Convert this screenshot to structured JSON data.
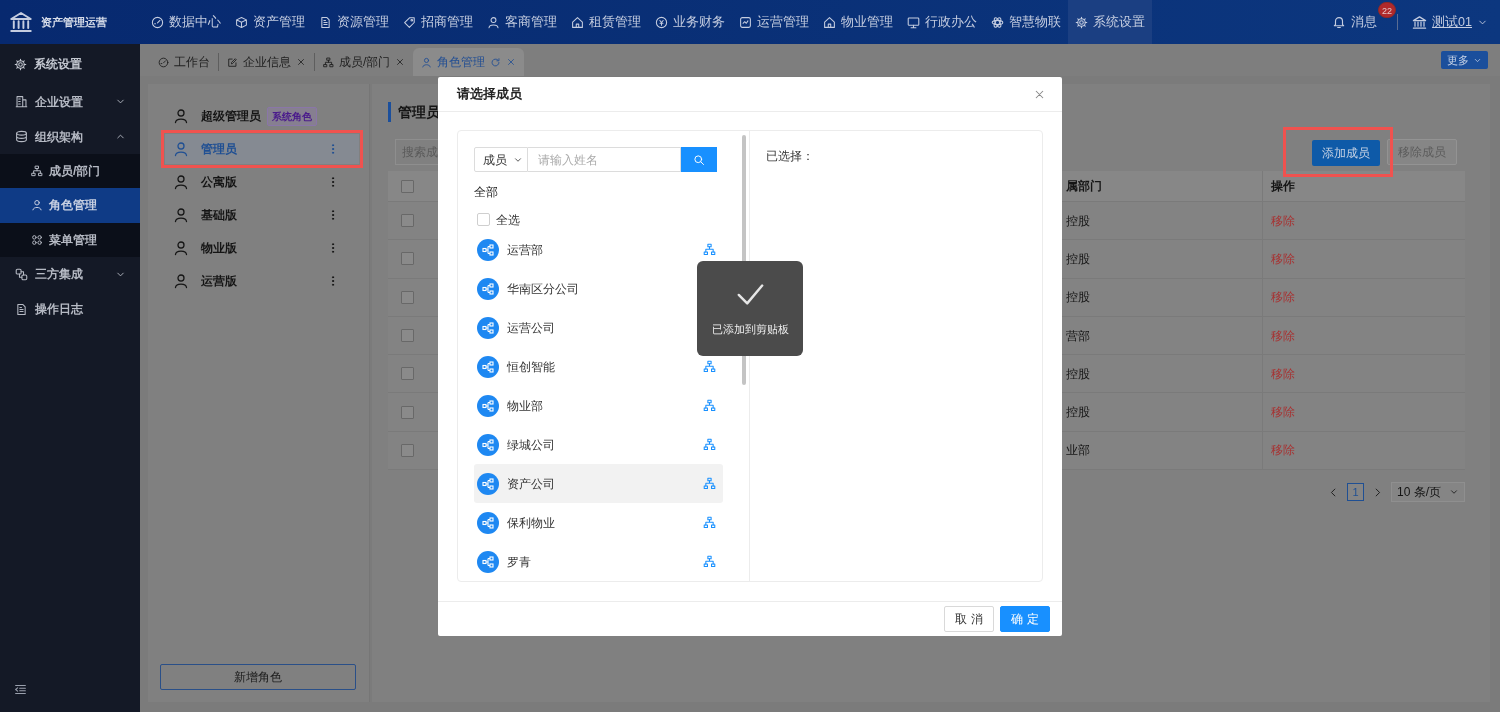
{
  "topbar": {
    "app_name": "资产管理运营",
    "nav": [
      {
        "label": "数据中心",
        "selected": false
      },
      {
        "label": "资产管理",
        "selected": false
      },
      {
        "label": "资源管理",
        "selected": false
      },
      {
        "label": "招商管理",
        "selected": false
      },
      {
        "label": "客商管理",
        "selected": false
      },
      {
        "label": "租赁管理",
        "selected": false
      },
      {
        "label": "业务财务",
        "selected": false
      },
      {
        "label": "运营管理",
        "selected": false
      },
      {
        "label": "物业管理",
        "selected": false
      },
      {
        "label": "行政办公",
        "selected": false
      },
      {
        "label": "智慧物联",
        "selected": false
      },
      {
        "label": "系统设置",
        "selected": true
      }
    ],
    "messages": {
      "label": "消息",
      "count": "22"
    },
    "user": {
      "name": "测试01"
    }
  },
  "sidebar": {
    "title": "系统设置",
    "items": [
      {
        "kind": "group",
        "label": "企业设置",
        "expanded": false
      },
      {
        "kind": "group",
        "label": "组织架构",
        "expanded": true,
        "children": [
          {
            "label": "成员/部门",
            "selected": false
          },
          {
            "label": "角色管理",
            "selected": true
          },
          {
            "label": "菜单管理",
            "selected": false
          }
        ]
      },
      {
        "kind": "group",
        "label": "三方集成",
        "expanded": false
      },
      {
        "kind": "link",
        "label": "操作日志"
      }
    ]
  },
  "tabs": [
    {
      "label": "工作台",
      "selected": false,
      "closable": false
    },
    {
      "label": "企业信息",
      "selected": false,
      "closable": true
    },
    {
      "label": "成员/部门",
      "selected": false,
      "closable": true
    },
    {
      "label": "角色管理",
      "selected": true,
      "closable": true
    }
  ],
  "more_button": "更多",
  "roles": {
    "items": [
      {
        "name": "超级管理员",
        "badge": "系统角色",
        "selected": false,
        "highlighted": false
      },
      {
        "name": "管理员",
        "selected": true,
        "highlighted": true
      },
      {
        "name": "公寓版",
        "selected": false,
        "highlighted": false
      },
      {
        "name": "基础版",
        "selected": false,
        "highlighted": false
      },
      {
        "name": "物业版",
        "selected": false,
        "highlighted": false
      },
      {
        "name": "运营版",
        "selected": false,
        "highlighted": false
      }
    ],
    "add_button": "新增角色"
  },
  "members_panel": {
    "title": "管理员",
    "search_placeholder": "搜索成",
    "add_button": {
      "label": "添加成员",
      "highlighted": true
    },
    "remove_button": {
      "label": "移除成员",
      "disabled": true
    },
    "table": {
      "columns": [
        "属部门",
        "操作"
      ],
      "header_checked": false,
      "rows": [
        {
          "checked": false,
          "column_1": "控股",
          "action": "移除"
        },
        {
          "checked": false,
          "column_1": "控股",
          "action": "移除"
        },
        {
          "checked": false,
          "column_1": "控股",
          "action": "移除"
        },
        {
          "checked": false,
          "column_1": "营部",
          "action": "移除"
        },
        {
          "checked": false,
          "column_1": "控股",
          "action": "移除"
        },
        {
          "checked": false,
          "column_1": "控股",
          "action": "移除"
        },
        {
          "checked": false,
          "column_1": "业部",
          "action": "移除"
        }
      ]
    },
    "pagination": {
      "pages": [
        {
          "label": "1",
          "selected": true
        }
      ],
      "page_size": "10 条/页"
    }
  },
  "modal": {
    "title": "请选择成员",
    "filter_type": "成员",
    "search_placeholder": "请输入姓名",
    "root_label": "全部",
    "select_all": {
      "label": "全选",
      "checked": false
    },
    "items": [
      {
        "name": "运营部",
        "hovered": false,
        "tree_button": true
      },
      {
        "name": "华南区分公司",
        "hovered": false,
        "tree_button": false
      },
      {
        "name": "运营公司",
        "hovered": false,
        "tree_button": false
      },
      {
        "name": "恒创智能",
        "hovered": false,
        "tree_button": true
      },
      {
        "name": "物业部",
        "hovered": false,
        "tree_button": true
      },
      {
        "name": "绿城公司",
        "hovered": false,
        "tree_button": true
      },
      {
        "name": "资产公司",
        "hovered": true,
        "tree_button": true
      },
      {
        "name": "保利物业",
        "hovered": false,
        "tree_button": true
      },
      {
        "name": "罗青",
        "hovered": false,
        "tree_button": true
      }
    ],
    "selected_title": "已选择：",
    "buttons": [
      {
        "label": "取 消",
        "kind": "secondary"
      },
      {
        "label": "确 定",
        "kind": "primary"
      }
    ]
  },
  "toast": {
    "message": "已添加到剪贴板"
  }
}
